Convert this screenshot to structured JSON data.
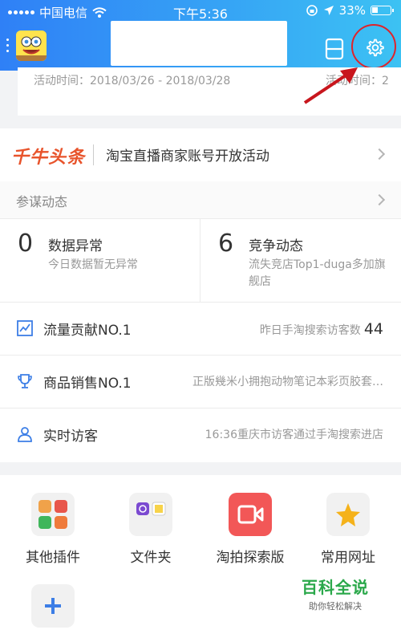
{
  "status_bar": {
    "carrier": "中国电信",
    "time": "下午5:36",
    "battery": "33%"
  },
  "activity": {
    "time_left": "活动时间：2018/03/26 - 2018/03/28",
    "time_right": "活动时间：2"
  },
  "news": {
    "logo": "千牛头条",
    "title": "淘宝直播商家账号开放活动"
  },
  "strategy": {
    "title": "参谋动态"
  },
  "stats": [
    {
      "num": "0",
      "label": "数据异常",
      "desc": "今日数据暂无异常"
    },
    {
      "num": "6",
      "label": "竞争动态",
      "desc": "流失竞店Top1-duga多加旗舰店"
    }
  ],
  "rank_rows": [
    {
      "title": "流量贡献NO.1",
      "value": "昨日手淘搜索访客数",
      "big": "44"
    },
    {
      "title": "商品销售NO.1",
      "value": "正版幾米小拥抱动物笔记本彩页胶套…",
      "big": ""
    },
    {
      "title": "实时访客",
      "value": "16:36重庆市访客通过手淘搜索进店",
      "big": ""
    }
  ],
  "tools": [
    {
      "label": "其他插件"
    },
    {
      "label": "文件夹"
    },
    {
      "label": "淘拍探索版"
    },
    {
      "label": "常用网址"
    }
  ],
  "watermark": {
    "line1": "百科全说",
    "line2": "助你轻松解决"
  }
}
